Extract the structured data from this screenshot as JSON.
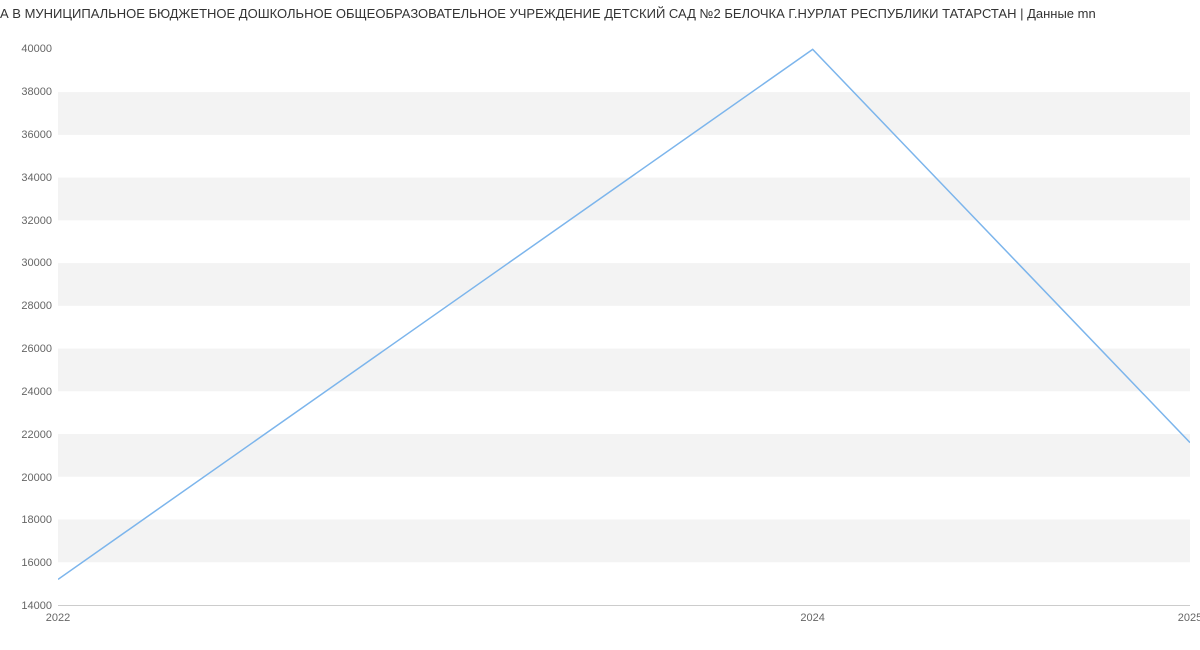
{
  "chart_data": {
    "type": "line",
    "title": "А В МУНИЦИПАЛЬНОЕ БЮДЖЕТНОЕ ДОШКОЛЬНОЕ ОБЩЕОБРАЗОВАТЕЛЬНОЕ УЧРЕЖДЕНИЕ ДЕТСКИЙ САД №2 БЕЛОЧКА Г.НУРЛАТ РЕСПУБЛИКИ ТАТАРСТАН | Данные mn",
    "x": [
      2022,
      2024,
      2025
    ],
    "values": [
      15200,
      40000,
      21600
    ],
    "x_ticks": [
      2022,
      2024,
      2025
    ],
    "y_ticks": [
      14000,
      16000,
      18000,
      20000,
      22000,
      24000,
      26000,
      28000,
      30000,
      32000,
      34000,
      36000,
      38000,
      40000
    ],
    "ylim": [
      14000,
      41000
    ],
    "xlabel": "",
    "ylabel": "",
    "line_color": "#7cb5ec"
  }
}
